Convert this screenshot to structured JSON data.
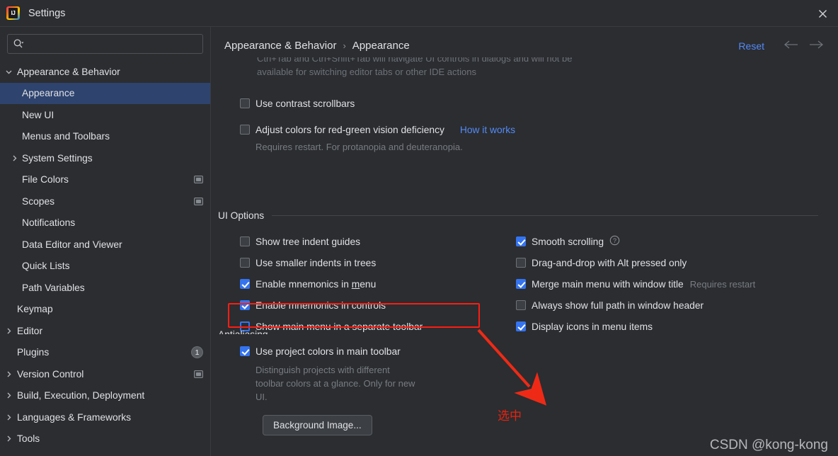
{
  "window": {
    "title": "Settings",
    "logo_icon": "intellij-idea-logo",
    "close_icon": "close-icon"
  },
  "sidebar": {
    "search": {
      "placeholder": "",
      "value": "",
      "icon": "search-icon"
    },
    "items": [
      {
        "label": "Appearance & Behavior",
        "level": 1,
        "expanded": true,
        "arrow": "chevron-down-icon",
        "selected": false,
        "trailing": "none"
      },
      {
        "label": "Appearance",
        "level": 2,
        "expanded": null,
        "arrow": "none",
        "selected": true,
        "trailing": "none"
      },
      {
        "label": "New UI",
        "level": 2,
        "expanded": null,
        "arrow": "none",
        "selected": false,
        "trailing": "none"
      },
      {
        "label": "Menus and Toolbars",
        "level": 2,
        "expanded": null,
        "arrow": "none",
        "selected": false,
        "trailing": "none"
      },
      {
        "label": "System Settings",
        "level": 2,
        "expanded": false,
        "arrow": "chevron-right-icon",
        "selected": false,
        "trailing": "none"
      },
      {
        "label": "File Colors",
        "level": 2,
        "expanded": null,
        "arrow": "none",
        "selected": false,
        "trailing": "project-scope-icon"
      },
      {
        "label": "Scopes",
        "level": 2,
        "expanded": null,
        "arrow": "none",
        "selected": false,
        "trailing": "project-scope-icon"
      },
      {
        "label": "Notifications",
        "level": 2,
        "expanded": null,
        "arrow": "none",
        "selected": false,
        "trailing": "none"
      },
      {
        "label": "Data Editor and Viewer",
        "level": 2,
        "expanded": null,
        "arrow": "none",
        "selected": false,
        "trailing": "none"
      },
      {
        "label": "Quick Lists",
        "level": 2,
        "expanded": null,
        "arrow": "none",
        "selected": false,
        "trailing": "none"
      },
      {
        "label": "Path Variables",
        "level": 2,
        "expanded": null,
        "arrow": "none",
        "selected": false,
        "trailing": "none"
      },
      {
        "label": "Keymap",
        "level": 1,
        "expanded": null,
        "arrow": "none",
        "selected": false,
        "trailing": "none"
      },
      {
        "label": "Editor",
        "level": 1,
        "expanded": false,
        "arrow": "chevron-right-icon",
        "selected": false,
        "trailing": "none"
      },
      {
        "label": "Plugins",
        "level": 1,
        "expanded": null,
        "arrow": "none",
        "selected": false,
        "trailing": "badge",
        "badge": "1"
      },
      {
        "label": "Version Control",
        "level": 1,
        "expanded": false,
        "arrow": "chevron-right-icon",
        "selected": false,
        "trailing": "project-scope-icon"
      },
      {
        "label": "Build, Execution, Deployment",
        "level": 1,
        "expanded": false,
        "arrow": "chevron-right-icon",
        "selected": false,
        "trailing": "none"
      },
      {
        "label": "Languages & Frameworks",
        "level": 1,
        "expanded": false,
        "arrow": "chevron-right-icon",
        "selected": false,
        "trailing": "none"
      },
      {
        "label": "Tools",
        "level": 1,
        "expanded": false,
        "arrow": "chevron-right-icon",
        "selected": false,
        "trailing": "none"
      }
    ]
  },
  "header": {
    "breadcrumb_root": "Appearance & Behavior",
    "breadcrumb_separator": "›",
    "breadcrumb_leaf": "Appearance",
    "reset_label": "Reset",
    "back_icon": "arrow-left-icon",
    "forward_icon": "arrow-right-icon"
  },
  "main": {
    "clipped_note_line1": "Ctrl+Tab and Ctrl+Shift+Tab will navigate UI controls in dialogs and will not be",
    "clipped_note_line2": "available for switching editor tabs or other IDE actions",
    "contrast_scrollbars": {
      "label": "Use contrast scrollbars",
      "checked": false
    },
    "adjust_colors": {
      "label": "Adjust colors for red-green vision deficiency",
      "checked": false,
      "link": "How it works",
      "note": "Requires restart. For protanopia and deuteranopia."
    },
    "ui_options": {
      "section_title": "UI Options",
      "left_column": [
        {
          "label": "Show tree indent guides",
          "checked": false,
          "focused": false,
          "mnemonic": ""
        },
        {
          "label": "Use smaller indents in trees",
          "checked": false,
          "focused": false,
          "mnemonic": ""
        },
        {
          "label": "Enable mnemonics in menu",
          "checked": true,
          "focused": false,
          "mnemonic": "m"
        },
        {
          "label": "Enable mnemonics in controls",
          "checked": true,
          "focused": false,
          "mnemonic": ""
        },
        {
          "label": "Show main menu in a separate toolbar",
          "checked": false,
          "focused": true,
          "mnemonic": ""
        }
      ],
      "right_column": [
        {
          "label": "Smooth scrolling",
          "checked": true,
          "help": true,
          "hint": ""
        },
        {
          "label": "Drag-and-drop with Alt pressed only",
          "checked": false,
          "help": false,
          "hint": ""
        },
        {
          "label": "Merge main menu with window title",
          "checked": true,
          "help": false,
          "hint": "Requires restart"
        },
        {
          "label": "Always show full path in window header",
          "checked": false,
          "help": false,
          "hint": ""
        },
        {
          "label": "Display icons in menu items",
          "checked": true,
          "help": false,
          "hint": ""
        }
      ],
      "project_colors": {
        "label": "Use project colors in main toolbar",
        "checked": true,
        "description": "Distinguish projects with different toolbar colors at a glance. Only for new UI."
      },
      "background_image_button": "Background Image..."
    },
    "next_section_cut_off": "Antialiasing"
  },
  "annotations": {
    "highlight_color": "#fc1d12",
    "arrow_color": "#ee2a16",
    "callout_text": "选中",
    "watermark": "CSDN @kong-kong"
  }
}
